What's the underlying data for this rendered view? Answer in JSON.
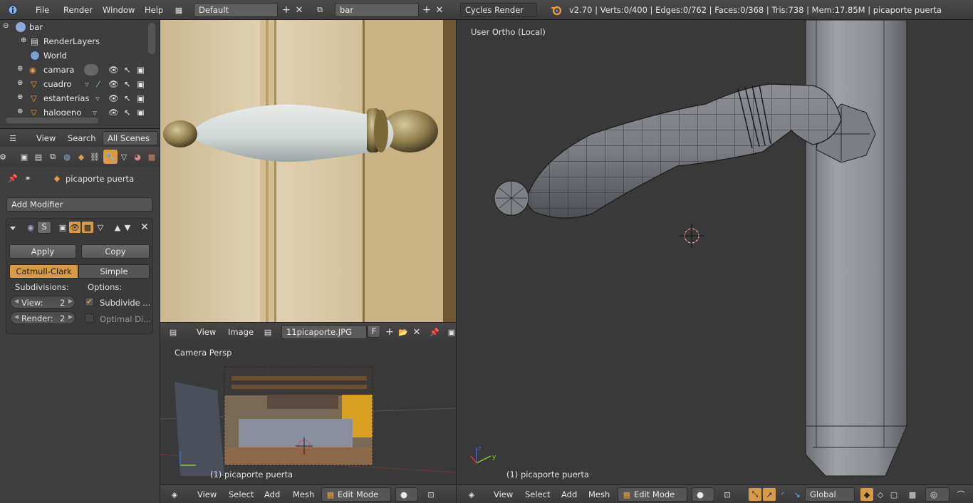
{
  "topbar": {
    "menus": [
      "File",
      "Render",
      "Window",
      "Help"
    ],
    "layout_field": "Default",
    "scene_field": "bar",
    "render_engine": "Cycles Render",
    "stats": "v2.70 | Verts:0/400 | Edges:0/762 | Faces:0/368 | Tris:738 | Mem:17.85M | picaporte puerta"
  },
  "outliner": {
    "items": [
      {
        "label": "bar"
      },
      {
        "label": "RenderLayers"
      },
      {
        "label": "World"
      },
      {
        "label": "camara"
      },
      {
        "label": "cuadro"
      },
      {
        "label": "estanterias"
      },
      {
        "label": "halogeno"
      }
    ],
    "header": {
      "view": "View",
      "search": "Search",
      "scenes": "All Scenes"
    }
  },
  "properties": {
    "object_name": "picaporte puerta",
    "add_modifier": "Add Modifier",
    "apply": "Apply",
    "copy": "Copy",
    "catmull": "Catmull-Clark",
    "simple": "Simple",
    "subdivisions_label": "Subdivisions:",
    "options_label": "Options:",
    "view_label": "View:",
    "view_value": "2",
    "render_label": "Render:",
    "render_value": "2",
    "subdivide_uvs": "Subdivide ...",
    "optimal_display": "Optimal Di...",
    "s_toggle": "S"
  },
  "image_editor": {
    "header": {
      "view": "View",
      "image": "Image",
      "image_name": "11picaporte.JPG",
      "fake_user": "F"
    }
  },
  "camera_view": {
    "title": "Camera Persp",
    "object_label": "(1) picaporte puerta",
    "header": {
      "view": "View",
      "select": "Select",
      "add": "Add",
      "mesh": "Mesh",
      "mode": "Edit Mode"
    }
  },
  "main_view": {
    "title": "User Ortho (Local)",
    "object_label": "(1) picaporte puerta",
    "header": {
      "view": "View",
      "select": "Select",
      "add": "Add",
      "mesh": "Mesh",
      "mode": "Edit Mode",
      "orientation": "Global"
    }
  },
  "colors": {
    "accent": "#d99a45",
    "bg": "#393939",
    "panel": "#3f3f3f"
  }
}
